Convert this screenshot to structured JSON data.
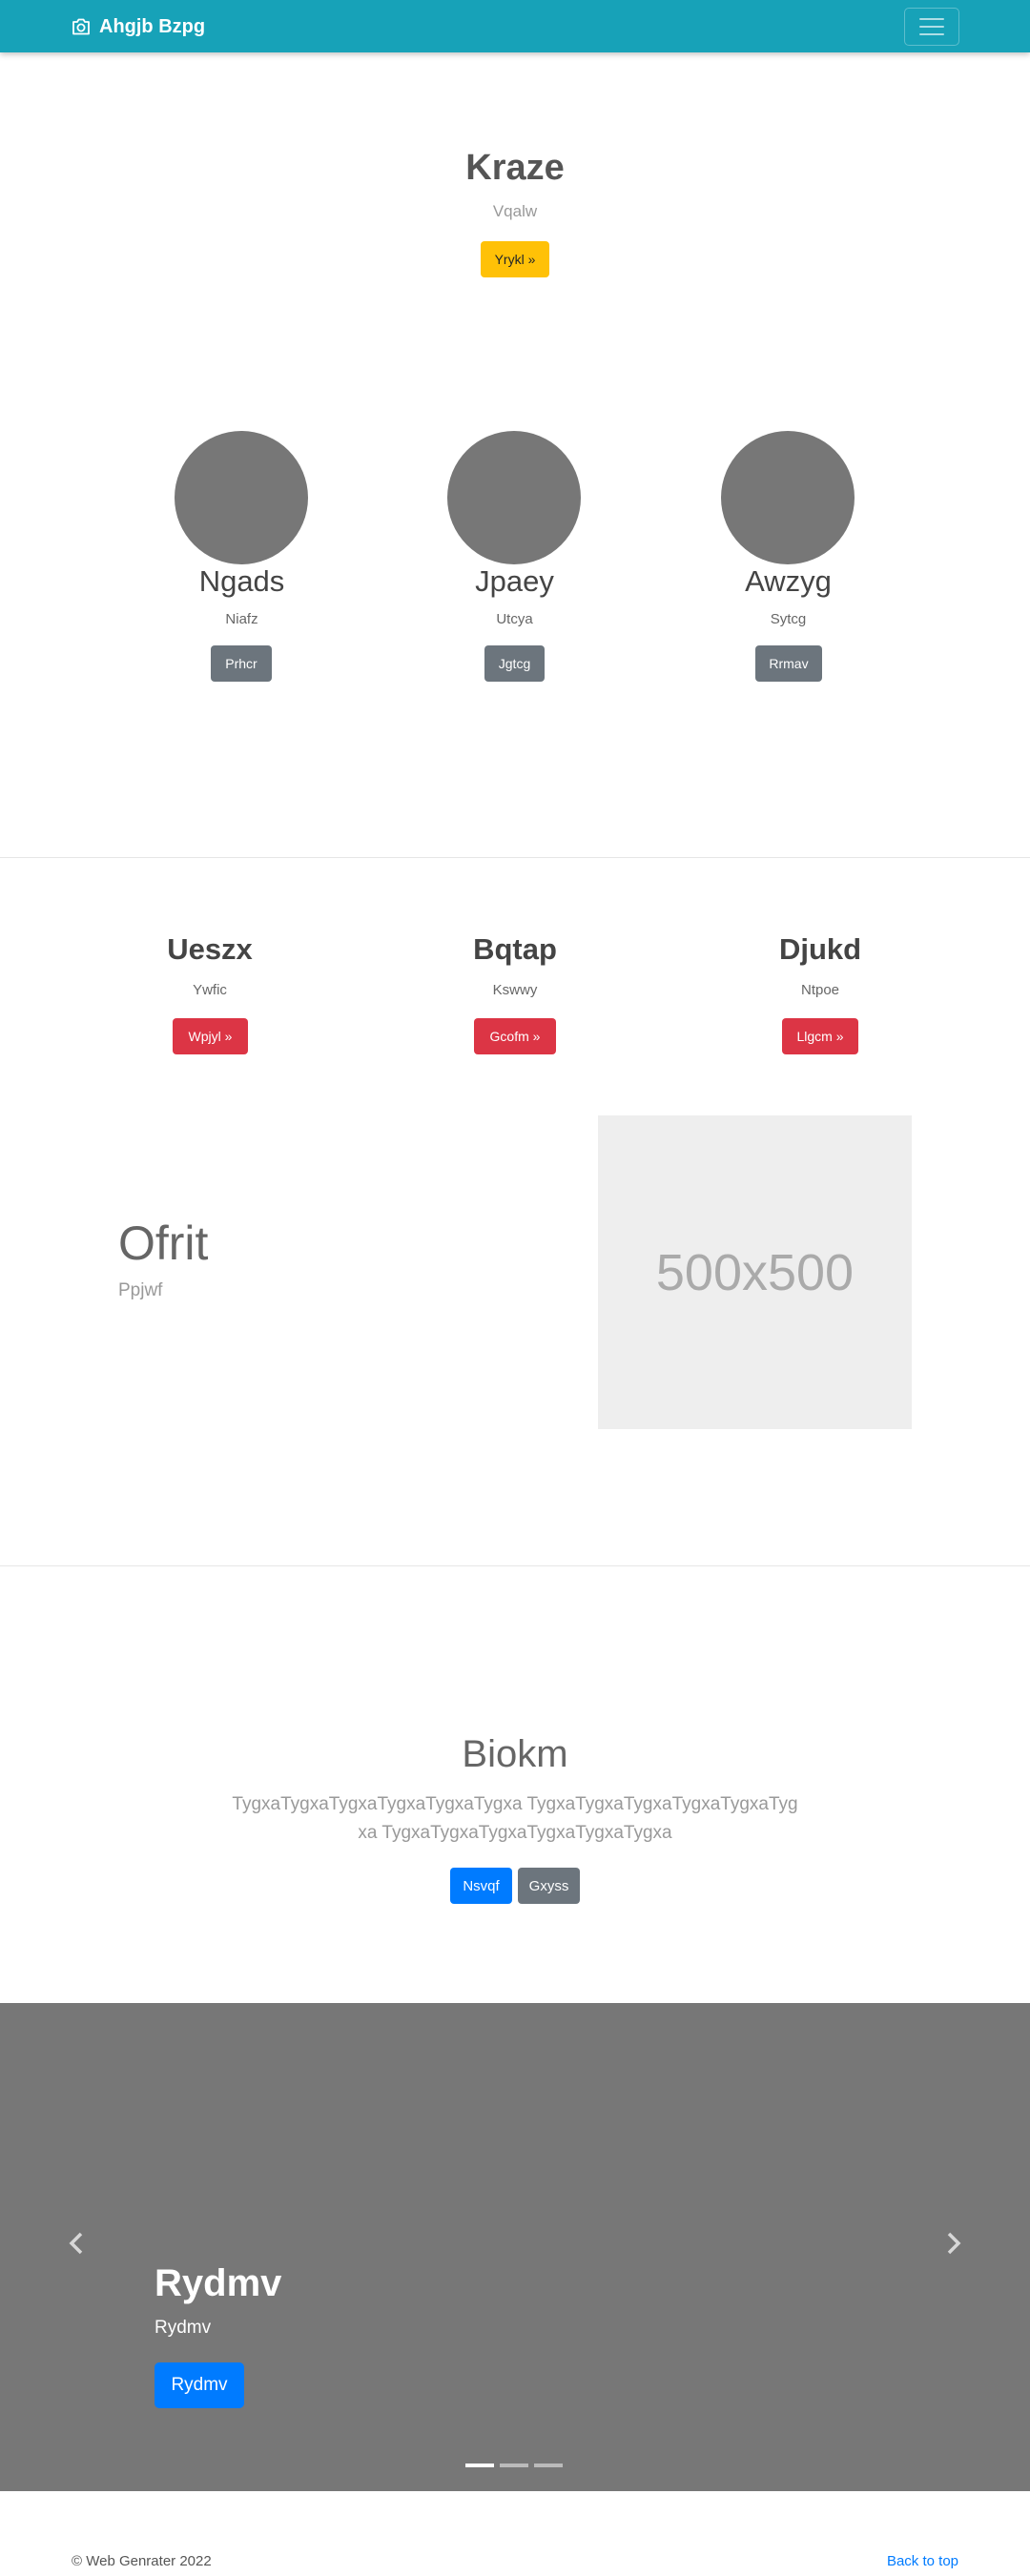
{
  "navbar": {
    "brand": "Ahgjb Bzpg",
    "brand_icon": "camera-icon",
    "toggler_icon": "hamburger-menu-icon",
    "bg_color": "#17a2b8"
  },
  "hero": {
    "title": "Kraze",
    "subtitle": "Vqalw",
    "button_label": "Yrykl »"
  },
  "circles": [
    {
      "title": "Ngads",
      "subtitle": "Niafz",
      "button_label": "Prhcr"
    },
    {
      "title": "Jpaey",
      "subtitle": "Utcya",
      "button_label": "Jgtcg"
    },
    {
      "title": "Awzyg",
      "subtitle": "Sytcg",
      "button_label": "Rrmav"
    }
  ],
  "features": [
    {
      "title": "Ueszx",
      "subtitle": "Ywfic",
      "button_label": "Wpjyl »"
    },
    {
      "title": "Bqtap",
      "subtitle": "Kswwy",
      "button_label": "Gcofm »"
    },
    {
      "title": "Djukd",
      "subtitle": "Ntpoe",
      "button_label": "Llgcm »"
    }
  ],
  "split": {
    "title": "Ofrit",
    "subtitle": "Ppjwf",
    "image_label": "500x500"
  },
  "jumbotron": {
    "title": "Biokm",
    "lead": "TygxaTygxaTygxaTygxaTygxaTygxa TygxaTygxaTygxaTygxaTygxaTygxa TygxaTygxaTygxaTygxaTygxaTygxa",
    "primary_label": "Nsvqf",
    "secondary_label": "Gxyss"
  },
  "carousel": {
    "caption_title": "Rydmv",
    "caption_subtitle": "Rydmv",
    "button_label": "Rydmv",
    "prev_icon": "chevron-left-icon",
    "next_icon": "chevron-right-icon",
    "slide_count": 3,
    "active_slide": 1
  },
  "footer": {
    "copyright": "© Web Genrater 2022",
    "back_to_top": "Back to top"
  }
}
